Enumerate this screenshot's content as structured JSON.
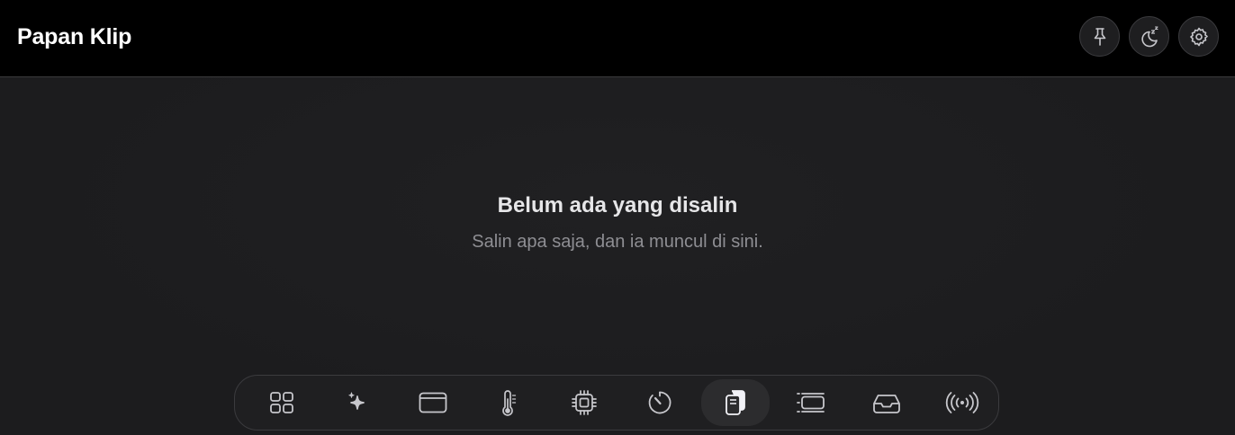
{
  "header": {
    "title": "Papan Klip",
    "actions": [
      {
        "name": "pin",
        "icon": "pin-icon"
      },
      {
        "name": "sleep",
        "icon": "moon-zzz-icon"
      },
      {
        "name": "settings",
        "icon": "gear-icon"
      }
    ]
  },
  "empty_state": {
    "title": "Belum ada yang disalin",
    "subtitle": "Salin apa saja, dan ia muncul di sini."
  },
  "dock": {
    "items": [
      {
        "id": "overview",
        "icon": "grid-icon",
        "active": false
      },
      {
        "id": "ai",
        "icon": "sparkles-icon",
        "active": false
      },
      {
        "id": "window",
        "icon": "window-icon",
        "active": false
      },
      {
        "id": "temperature",
        "icon": "thermometer-icon",
        "active": false
      },
      {
        "id": "processor",
        "icon": "cpu-chip-icon",
        "active": false
      },
      {
        "id": "timer",
        "icon": "timer-icon",
        "active": false
      },
      {
        "id": "clipboard",
        "icon": "clipboard-icon",
        "active": true
      },
      {
        "id": "list",
        "icon": "list-icon",
        "active": false
      },
      {
        "id": "inbox",
        "icon": "inbox-tray-icon",
        "active": false
      },
      {
        "id": "broadcast",
        "icon": "broadcast-icon",
        "active": false
      }
    ]
  },
  "colors": {
    "topbar_bg": "#000000",
    "content_bg": "#1d1d1f",
    "text_primary": "#e6e6e8",
    "text_secondary": "#8e8e93",
    "icon": "#c7c7cc"
  }
}
